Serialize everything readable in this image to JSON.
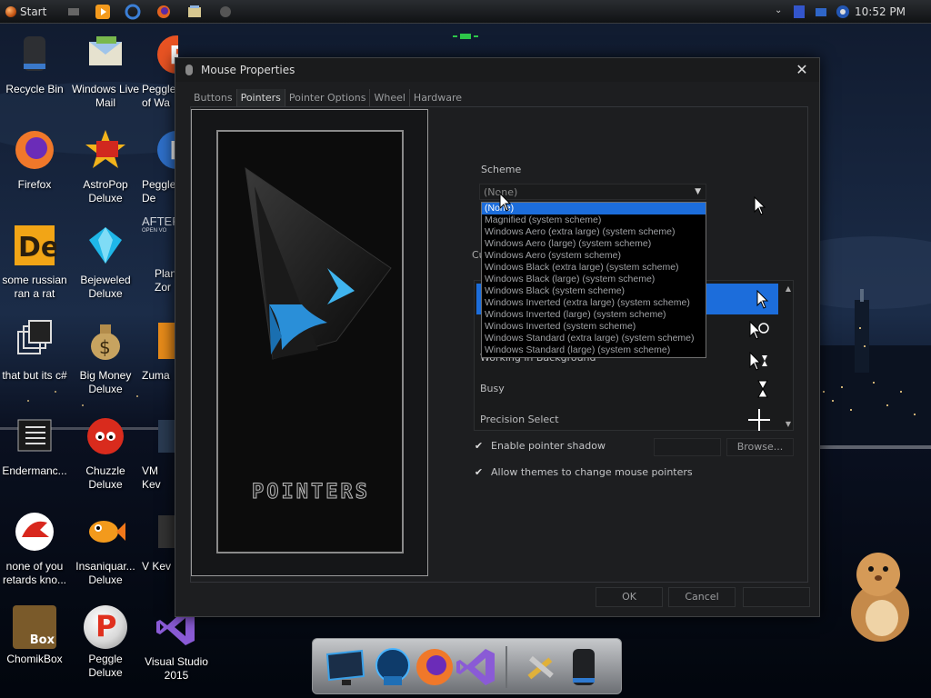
{
  "taskbar": {
    "start_label": "Start",
    "clock": "10:52 PM"
  },
  "desktop": {
    "icons": [
      {
        "label": "Recycle Bin",
        "icon": "recycle-bin-icon"
      },
      {
        "label": "Windows Live Mail",
        "icon": "mail-icon"
      },
      {
        "label": "Peggle of Wa",
        "icon": "peggle-icon"
      },
      {
        "label": "Firefox",
        "icon": "firefox-icon"
      },
      {
        "label": "AstroPop Deluxe",
        "icon": "astropop-icon"
      },
      {
        "label": "Peggle De",
        "icon": "peggle-icon"
      },
      {
        "label": "some russian ran a rat",
        "icon": "de-icon"
      },
      {
        "label": "Bejeweled Deluxe",
        "icon": "gem-icon"
      },
      {
        "label": "Plan Zor",
        "icon": "afterburner-icon"
      },
      {
        "label": "that but its c#",
        "icon": "copy-icon"
      },
      {
        "label": "Big Money Deluxe",
        "icon": "money-bag-icon"
      },
      {
        "label": "Zuma",
        "icon": "zuma-icon"
      },
      {
        "label": "Endermanc...",
        "icon": "list-icon"
      },
      {
        "label": "Chuzzle Deluxe",
        "icon": "chuzzle-icon"
      },
      {
        "label": "VM Kev",
        "icon": "vm-icon"
      },
      {
        "label": "none of you retards kno...",
        "icon": "raptor-icon"
      },
      {
        "label": "Insaniquar... Deluxe",
        "icon": "goldfish-icon"
      },
      {
        "label": "V Kev",
        "icon": "v-icon"
      },
      {
        "label": "ChomikBox",
        "icon": "hamster-box-icon",
        "badge": "Box"
      },
      {
        "label": "Peggle Deluxe",
        "icon": "peggle-icon",
        "badge": "P"
      },
      {
        "label": "Visual Studio 2015",
        "icon": "visual-studio-icon"
      }
    ],
    "afterburner_text": "AFTER",
    "afterburner_small": "OPEN VO"
  },
  "dialog": {
    "title": "Mouse Properties",
    "close": "✕",
    "tabs": [
      "Buttons",
      "Pointers",
      "Pointer Options",
      "Wheel",
      "Hardware"
    ],
    "active_tab": "Pointers",
    "preview_text": "POINTERS",
    "scheme": {
      "label": "Scheme",
      "value": "(None)",
      "arrow": "▼",
      "options": [
        "(None)",
        "Magnified (system scheme)",
        "Windows Aero (extra large) (system scheme)",
        "Windows Aero (large) (system scheme)",
        "Windows Aero (system scheme)",
        "Windows Black (extra large) (system scheme)",
        "Windows Black (large) (system scheme)",
        "Windows Black (system scheme)",
        "Windows Inverted (extra large) (system scheme)",
        "Windows Inverted (large) (system scheme)",
        "Windows Inverted (system scheme)",
        "Windows Standard (extra large) (system scheme)",
        "Windows Standard (large) (system scheme)"
      ],
      "selected_index": 0
    },
    "customize_label": "Cu",
    "cursor_rows": [
      {
        "label": "Working in Background",
        "icon": "arrow-hourglass-icon"
      },
      {
        "label": "Busy",
        "icon": "hourglass-icon"
      },
      {
        "label": "Precision Select",
        "icon": "crosshair-icon"
      }
    ],
    "scroll_up": "▲",
    "scroll_down": "▼",
    "checkboxes": [
      {
        "label": "Enable pointer shadow",
        "checked": true,
        "mark": "✔"
      },
      {
        "label": "Allow themes to change mouse pointers",
        "checked": true,
        "mark": "✔"
      }
    ],
    "browse_label": "Browse...",
    "ok_label": "OK",
    "cancel_label": "Cancel"
  },
  "colors": {
    "selection_blue": "#1c6ddb",
    "dialog_bg": "#1d1e20",
    "dock_grey": "#9a9da1"
  }
}
